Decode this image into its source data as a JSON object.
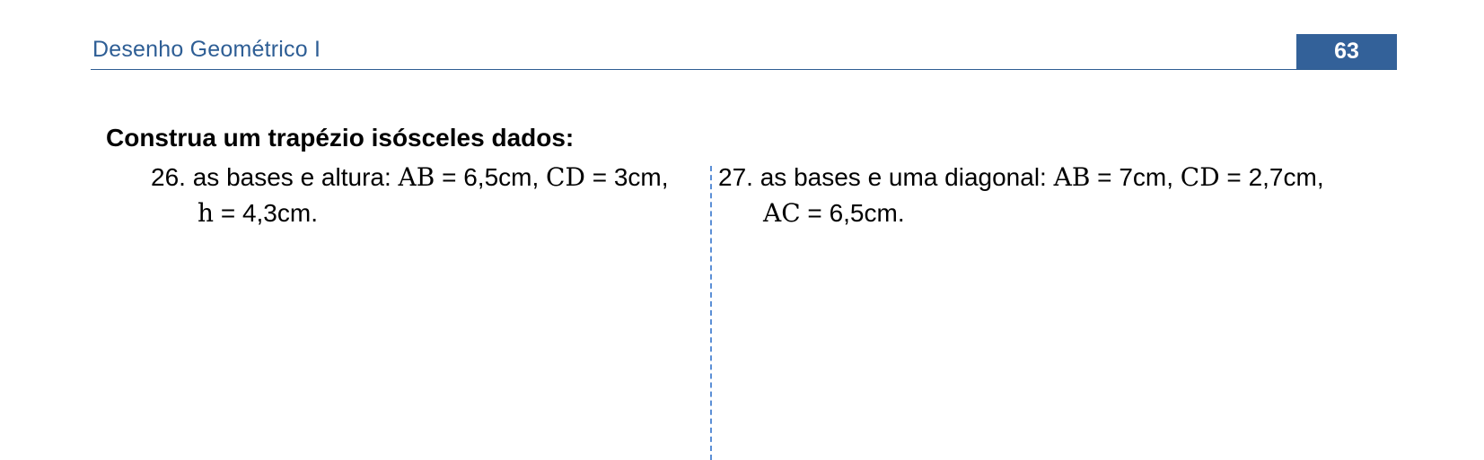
{
  "header": {
    "title": "Desenho Geométrico I",
    "page_number": "63"
  },
  "section": {
    "heading": "Construa um trapézio isósceles dados:"
  },
  "exercises": [
    {
      "number": "26.",
      "line1_prefix": "as bases e altura:",
      "ab_label": "AB",
      "ab_value": " = 6,5cm,",
      "cd_label": "CD",
      "cd_value": " = 3cm,",
      "h_label": "h",
      "h_value": " = 4,3cm."
    },
    {
      "number": "27.",
      "line1_prefix": "as bases e uma diagonal:",
      "ab_label": "AB",
      "ab_value": " = 7cm,",
      "cd_label": "CD",
      "cd_value": " = 2,7cm,",
      "ac_label": "AC",
      "ac_value": " = 6,5cm."
    }
  ],
  "colors": {
    "accent": "#336199",
    "title_text": "#2e5e95",
    "divider": "#5b8fd6"
  }
}
